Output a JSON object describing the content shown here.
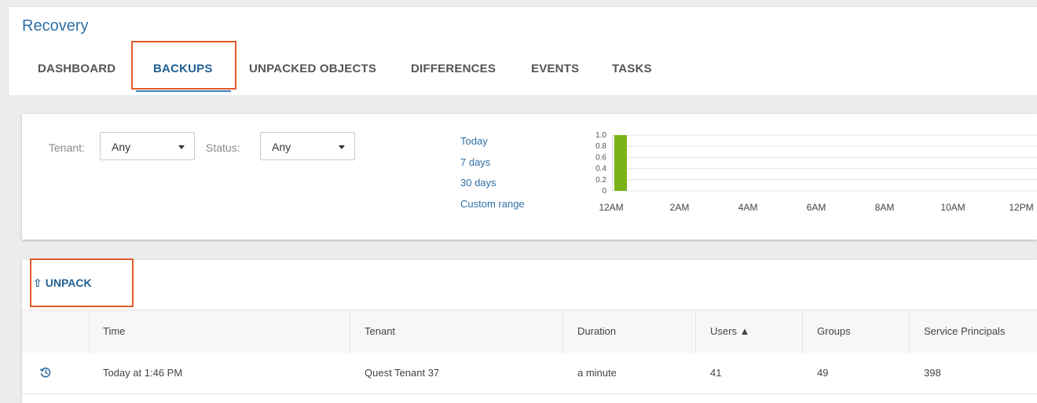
{
  "header": {
    "title": "Recovery",
    "tabs": [
      "DASHBOARD",
      "BACKUPS",
      "UNPACKED OBJECTS",
      "DIFFERENCES",
      "EVENTS",
      "TASKS"
    ],
    "active_tab": "BACKUPS"
  },
  "filters": {
    "tenant_label": "Tenant:",
    "tenant_value": "Any",
    "status_label": "Status:",
    "status_value": "Any",
    "ranges": [
      "Today",
      "7 days",
      "30 days",
      "Custom range"
    ]
  },
  "chart_data": {
    "type": "bar",
    "x_tick_labels": [
      "12AM",
      "2AM",
      "4AM",
      "6AM",
      "8AM",
      "10AM",
      "12PM"
    ],
    "y_tick_labels": [
      "1.0",
      "0.8",
      "0.6",
      "0.4",
      "0.2",
      "0"
    ],
    "ylim": [
      0,
      1.0
    ],
    "bars": [
      {
        "x": "12AM",
        "value": 1.0
      }
    ],
    "bar_color": "#7ab317",
    "grid": true
  },
  "toolbar": {
    "unpack_label": "UNPACK",
    "unpack_icon": "upload-icon"
  },
  "table": {
    "columns": [
      "Time",
      "Tenant",
      "Duration",
      "Users ▲",
      "Groups",
      "Service Principals"
    ],
    "rows": [
      {
        "time": "Today at 1:46 PM",
        "tenant": "Quest Tenant 37",
        "duration": "a minute",
        "users": "41",
        "groups": "49",
        "service_principals": "398"
      }
    ]
  },
  "colors": {
    "accent": "#2f6fa6",
    "highlight": "#e25b2c",
    "bar": "#7ab317"
  }
}
